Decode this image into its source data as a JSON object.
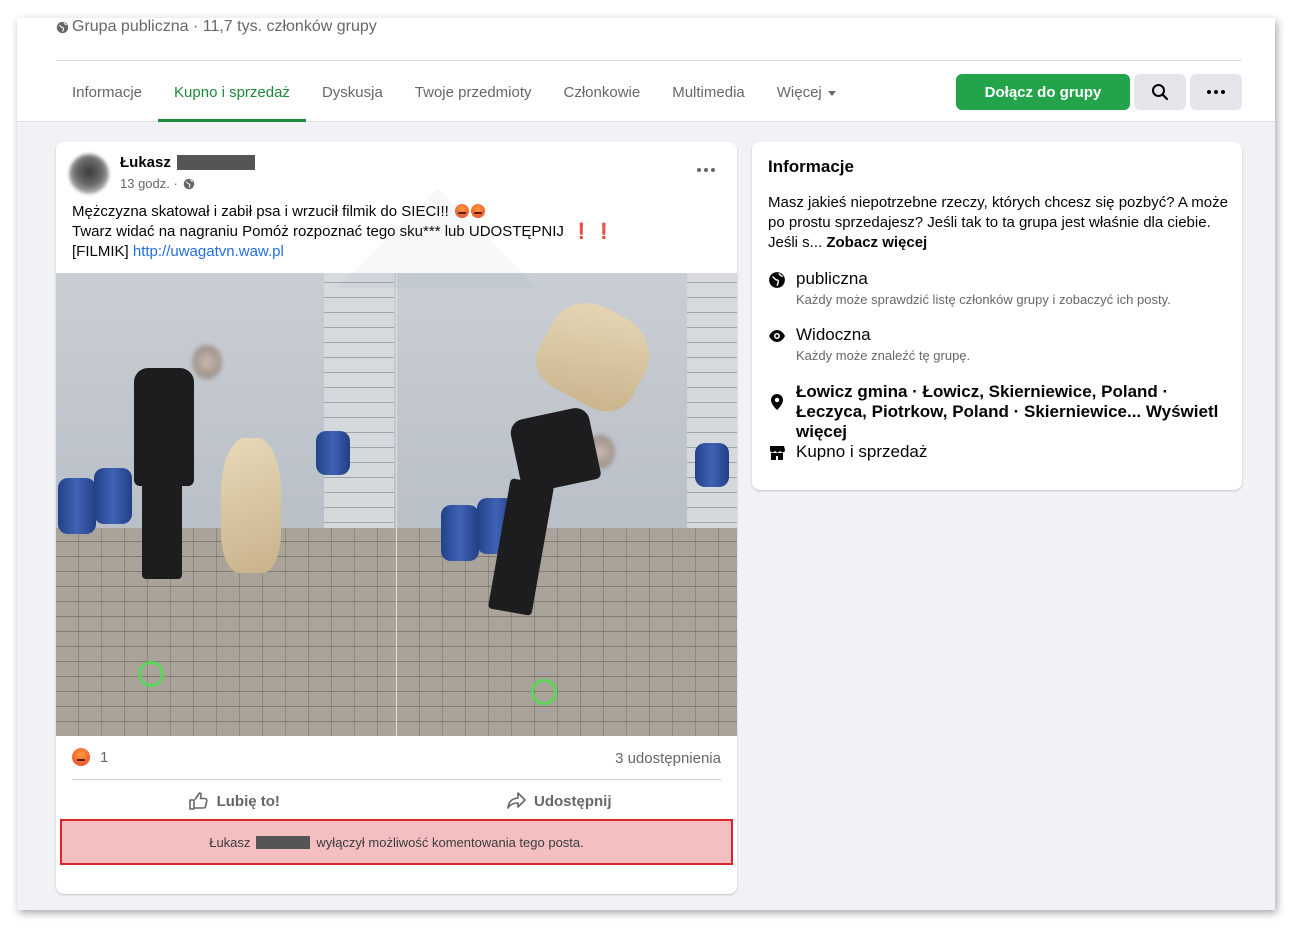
{
  "group": {
    "meta": "Grupa publiczna · 11,7 tys. członków grupy"
  },
  "tabs": [
    {
      "label": "Informacje"
    },
    {
      "label": "Kupno i sprzedaż"
    },
    {
      "label": "Dyskusja"
    },
    {
      "label": "Twoje przedmioty"
    },
    {
      "label": "Członkowie"
    },
    {
      "label": "Multimedia"
    },
    {
      "label": "Więcej"
    }
  ],
  "header_actions": {
    "join_label": "Dołącz do grupy"
  },
  "post": {
    "author": "Łukasz",
    "time": "13 godz. ·",
    "line1": "Mężczyzna skatował i zabił psa i wrzucił filmik do SIECI!!",
    "line2": "Twarz widać na nagraniu Pomóż rozpoznać tego sku*** lub UDOSTĘPNIJ",
    "line3_prefix": "[FILMIK]",
    "link": "http://uwagatvn.waw.pl",
    "reaction_count": "1",
    "shares": "3 udostępnienia",
    "like_label": "Lubię to!",
    "share_label": "Udostępnij",
    "comments_off_author": "Łukasz",
    "comments_off_text": "wyłączył możliwość komentowania tego posta."
  },
  "info": {
    "title": "Informacje",
    "description": "Masz jakieś niepotrzebne rzeczy, których chcesz się pozbyć? A może po prostu sprzedajesz? Jeśli tak to ta grupa jest właśnie dla ciebie. Jeśli s...",
    "see_more": "Zobacz więcej",
    "public_title": "publiczna",
    "public_sub": "Każdy może sprawdzić listę członków grupy i zobaczyć ich posty.",
    "visible_title": "Widoczna",
    "visible_sub": "Każdy może znaleźć tę grupę.",
    "location": "Łowicz gmina · Łowicz, Skierniewice, Poland · Łeczyca, Piotrkow, Poland · Skierniewice...",
    "location_more": "Wyświetl więcej",
    "category": "Kupno i sprzedaż"
  },
  "colors": {
    "accent": "#1b8b3a",
    "join_button": "#23a34a",
    "link": "#216fdb",
    "highlight_border": "#d8252b",
    "highlight_bg": "#f4bfc1"
  }
}
